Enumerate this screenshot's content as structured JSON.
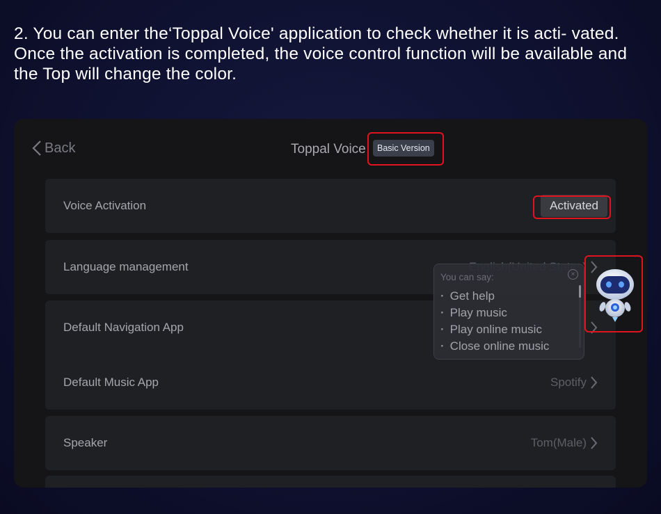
{
  "instruction": "2. You can enter the‘Toppal Voice' application to check whether it is acti- vated. Once the activation is completed, the voice control function will be available and the Top will change the color.",
  "topbar": {
    "back_label": "Back",
    "title": "Toppal Voice",
    "badge": "Basic Version"
  },
  "settings": {
    "voice_activation": {
      "label": "Voice Activation",
      "status": "Activated"
    },
    "language": {
      "label": "Language management",
      "value": "English(United States)"
    },
    "navigation": {
      "label": "Default Navigation App"
    },
    "music": {
      "label": "Default Music App",
      "value": "Spotify"
    },
    "speaker": {
      "label": "Speaker",
      "value": "Tom(Male)"
    }
  },
  "bubble": {
    "title": "You can say:",
    "items": [
      "Get help",
      "Play music",
      "Play online music",
      "Close online music"
    ]
  },
  "colors": {
    "highlight": "#e0141e",
    "background": "#0f1130",
    "panel": "#151518",
    "card": "#1f2024"
  }
}
